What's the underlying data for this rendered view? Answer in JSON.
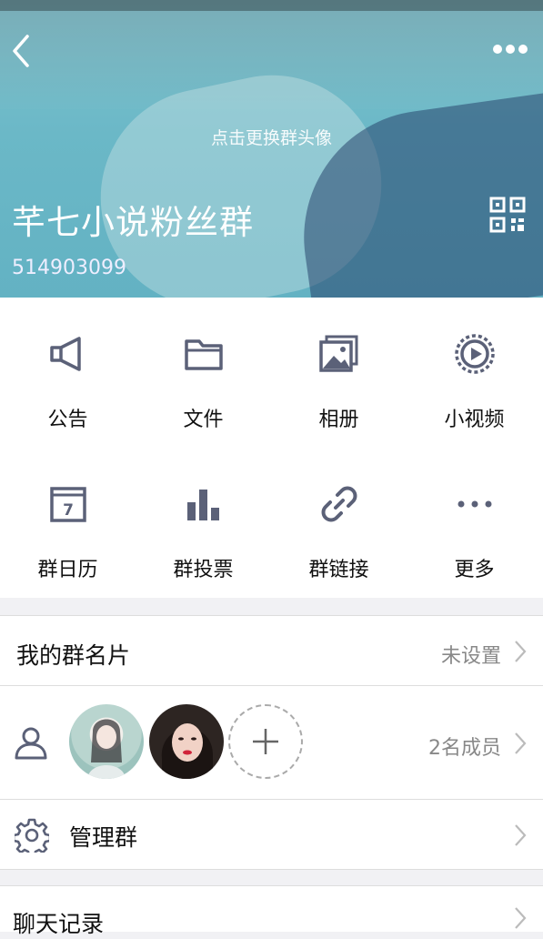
{
  "header": {
    "change_avatar_hint": "点击更换群头像",
    "group_name": "芊七小说粉丝群",
    "group_id": "514903099",
    "icons": {
      "back": "back-chevron-icon",
      "more": "more-dots-icon",
      "qr": "qr-code-icon"
    }
  },
  "features": [
    {
      "label": "公告",
      "icon": "megaphone-icon"
    },
    {
      "label": "文件",
      "icon": "folder-icon"
    },
    {
      "label": "相册",
      "icon": "album-icon"
    },
    {
      "label": "小视频",
      "icon": "video-icon"
    },
    {
      "label": "群日历",
      "icon": "calendar-icon"
    },
    {
      "label": "群投票",
      "icon": "bar-chart-icon"
    },
    {
      "label": "群链接",
      "icon": "link-icon"
    },
    {
      "label": "更多",
      "icon": "more-dots-icon"
    }
  ],
  "calendar_day": "7",
  "my_card": {
    "label": "我的群名片",
    "value": "未设置"
  },
  "members": {
    "count_text": "2名成员",
    "icons": {
      "members": "members-icon",
      "add": "add-member-icon"
    }
  },
  "manage": {
    "label": "管理群",
    "icon": "gear-icon"
  },
  "chat_history": {
    "label": "聊天记录"
  },
  "colors": {
    "icon_gray": "#5b6178",
    "hero": "#6bb8c7"
  }
}
